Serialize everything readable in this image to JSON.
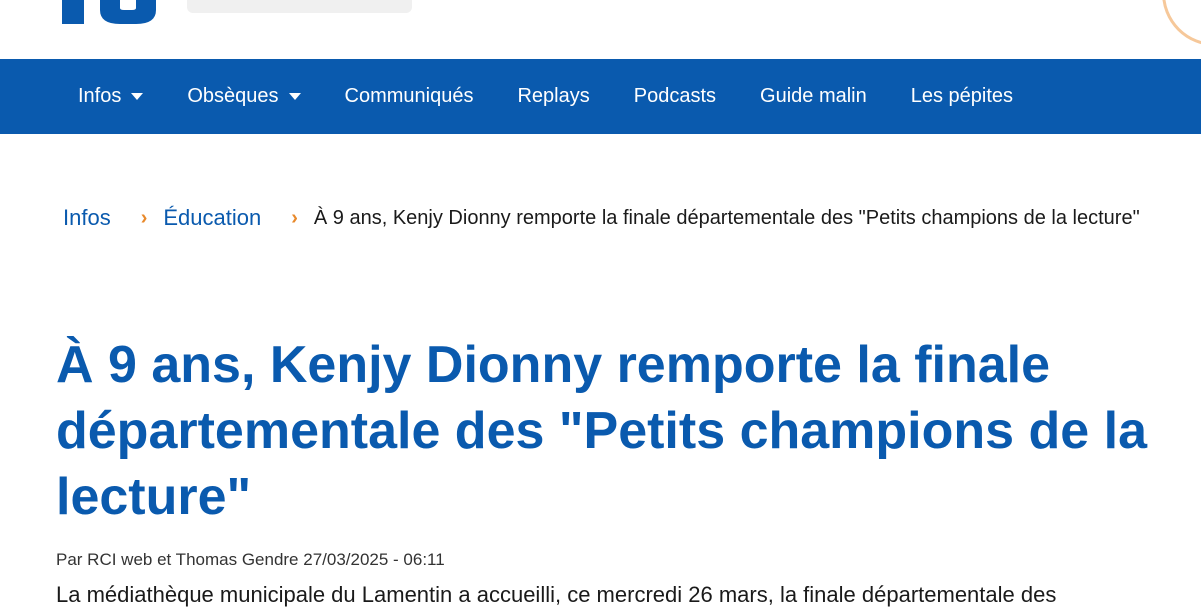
{
  "header": {
    "logo_icon": "site-logo-icon",
    "search_placeholder": ""
  },
  "nav": {
    "items": [
      {
        "label": "Infos",
        "has_dropdown": true
      },
      {
        "label": "Obsèques",
        "has_dropdown": true
      },
      {
        "label": "Communiqués",
        "has_dropdown": false
      },
      {
        "label": "Replays",
        "has_dropdown": false
      },
      {
        "label": "Podcasts",
        "has_dropdown": false
      },
      {
        "label": "Guide malin",
        "has_dropdown": false
      },
      {
        "label": "Les pépites",
        "has_dropdown": false
      }
    ]
  },
  "breadcrumb": {
    "items": [
      "Infos",
      "Éducation"
    ],
    "separator": "›",
    "current": "À 9 ans, Kenjy Dionny remporte la finale départementale des \"Petits champions de la lecture\""
  },
  "article": {
    "title": "À 9 ans, Kenjy Dionny remporte la finale départementale des \"Petits champions de la lecture\"",
    "byline": "Par RCI web et Thomas Gendre 27/03/2025 - 06:11",
    "intro": "La médiathèque municipale du Lamentin a accueilli, ce mercredi 26 mars, la finale départementale des"
  },
  "colors": {
    "brand_blue": "#0a5aae",
    "accent_orange": "#e8892b"
  }
}
